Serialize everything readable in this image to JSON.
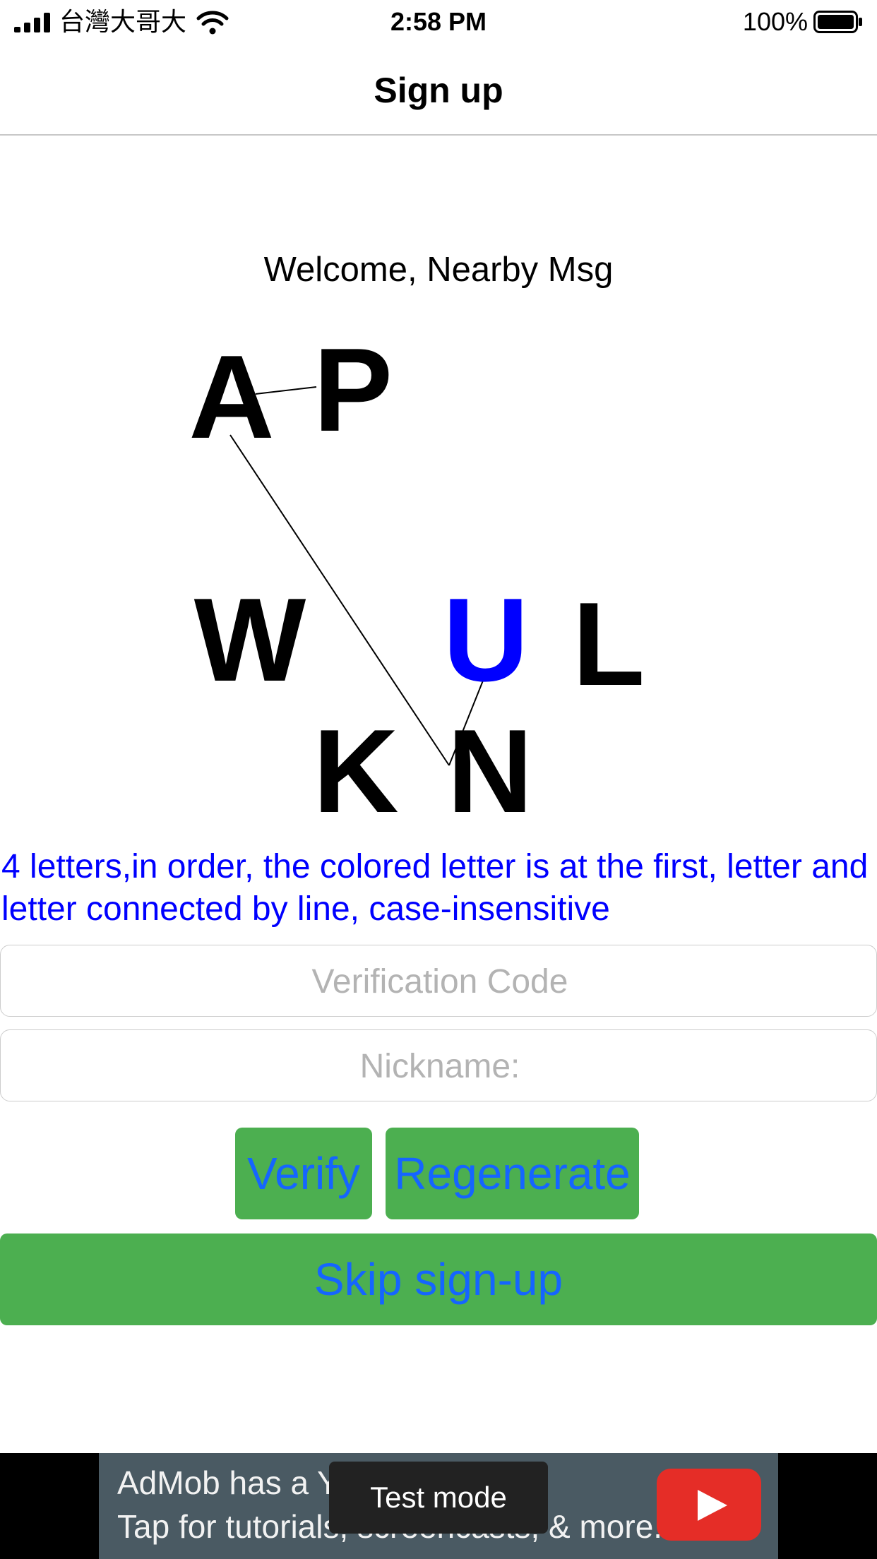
{
  "status_bar": {
    "carrier": "台灣大哥大",
    "time": "2:58 PM",
    "battery_percent": "100%"
  },
  "nav": {
    "title": "Sign up"
  },
  "welcome": "Welcome, Nearby Msg",
  "captcha": {
    "letters": [
      "A",
      "P",
      "W",
      "U",
      "L",
      "K",
      "N"
    ],
    "highlighted_letter": "U",
    "highlight_color": "#0000ff"
  },
  "hint": "4 letters,in order, the colored letter is at the first, letter and letter connected by line, case-insensitive",
  "form": {
    "verification_placeholder": "Verification Code",
    "nickname_placeholder": "Nickname:"
  },
  "buttons": {
    "verify": "Verify",
    "regenerate": "Regenerate",
    "skip": "Skip sign-up"
  },
  "ad": {
    "line1": "AdMob has a Yo",
    "line2": "Tap for tutorials, screencasts, & more.",
    "test_mode": "Test mode"
  },
  "colors": {
    "button_bg": "#4caf50",
    "button_text": "#1565ff",
    "hint_text": "#0000ff"
  }
}
